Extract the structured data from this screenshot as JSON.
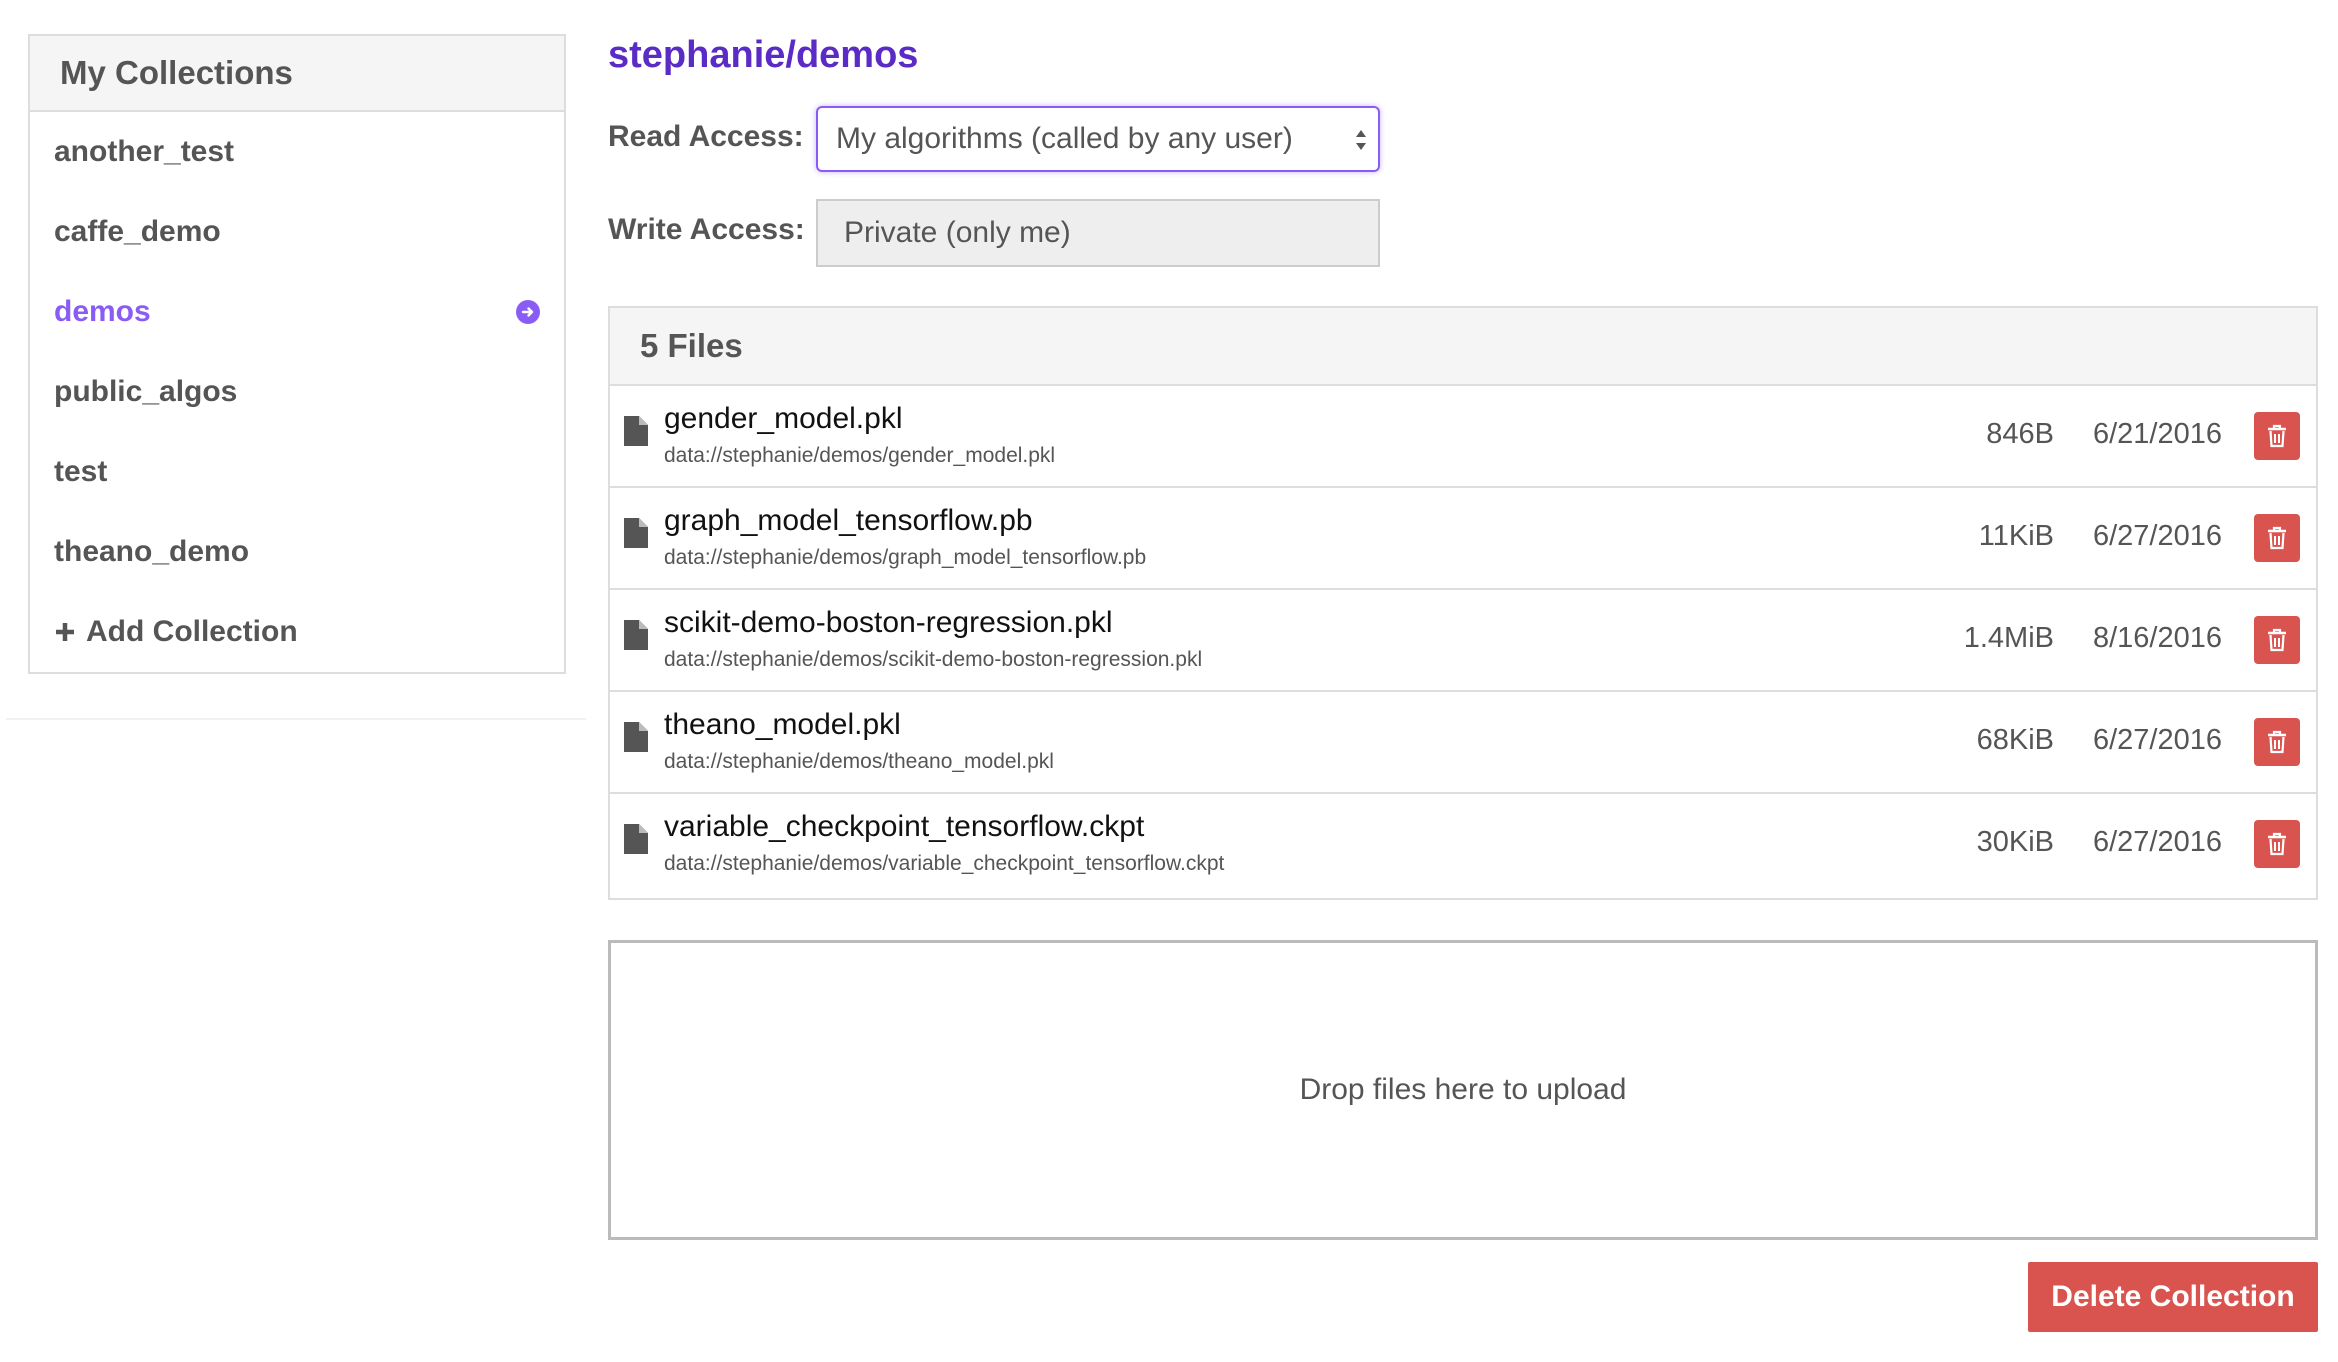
{
  "sidebar": {
    "title": "My Collections",
    "items": [
      {
        "label": "another_test"
      },
      {
        "label": "caffe_demo"
      },
      {
        "label": "demos"
      },
      {
        "label": "public_algos"
      },
      {
        "label": "test"
      },
      {
        "label": "theano_demo"
      }
    ],
    "add_label": "Add Collection"
  },
  "main": {
    "collection_title": "stephanie/demos",
    "read_access": {
      "label": "Read Access:",
      "value": "My algorithms (called by any user)"
    },
    "write_access": {
      "label": "Write Access:",
      "value": "Private (only me)"
    },
    "files": {
      "header": "5 Files",
      "rows": [
        {
          "name": "gender_model.pkl",
          "path": "data://stephanie/demos/gender_model.pkl",
          "size": "846B",
          "date": "6/21/2016"
        },
        {
          "name": "graph_model_tensorflow.pb",
          "path": "data://stephanie/demos/graph_model_tensorflow.pb",
          "size": "11KiB",
          "date": "6/27/2016"
        },
        {
          "name": "scikit-demo-boston-regression.pkl",
          "path": "data://stephanie/demos/scikit-demo-boston-regression.pkl",
          "size": "1.4MiB",
          "date": "8/16/2016"
        },
        {
          "name": "theano_model.pkl",
          "path": "data://stephanie/demos/theano_model.pkl",
          "size": "68KiB",
          "date": "6/27/2016"
        },
        {
          "name": "variable_checkpoint_tensorflow.ckpt",
          "path": "data://stephanie/demos/variable_checkpoint_tensorflow.ckpt",
          "size": "30KiB",
          "date": "6/27/2016"
        }
      ]
    },
    "dropzone_text": "Drop files here to upload",
    "delete_label": "Delete Collection"
  },
  "colors": {
    "accent": "#8a5cf6",
    "title": "#5b2bc5",
    "danger": "#d9534f"
  },
  "icons": {
    "active_item": "circle-arrow-right-icon",
    "add": "plus-icon",
    "file": "file-icon",
    "delete": "trash-icon"
  }
}
